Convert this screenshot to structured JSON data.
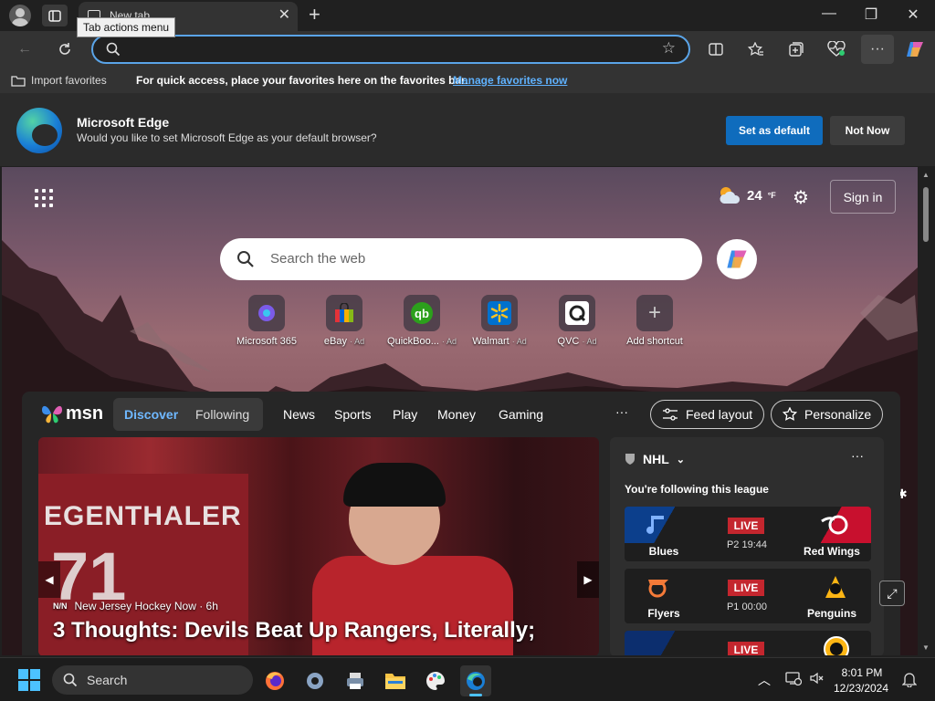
{
  "browser": {
    "tab_title": "New tab",
    "tooltip": "Tab actions menu",
    "address_value": "",
    "favorites_bar": {
      "import_label": "Import favorites",
      "hint": "For quick access, place your favorites here on the favorites bar.",
      "manage_link": "Manage favorites now"
    }
  },
  "banner": {
    "title": "Microsoft Edge",
    "message": "Would you like to set Microsoft Edge as your default browser?",
    "set_default": "Set as default",
    "not_now": "Not Now"
  },
  "ntp": {
    "weather_temp": "24",
    "weather_unit": "°F",
    "signin": "Sign in",
    "search_placeholder": "Search the web",
    "tiles": [
      {
        "label": "Microsoft 365",
        "ad": ""
      },
      {
        "label": "eBay",
        "ad": "· Ad"
      },
      {
        "label": "QuickBoo...",
        "ad": "· Ad"
      },
      {
        "label": "Walmart",
        "ad": "· Ad"
      },
      {
        "label": "QVC",
        "ad": "· Ad"
      },
      {
        "label": "Add shortcut",
        "ad": ""
      }
    ]
  },
  "msn": {
    "logo": "msn",
    "tabs": [
      "Discover",
      "Following"
    ],
    "nav": [
      "News",
      "Sports",
      "Play",
      "Money",
      "Gaming"
    ],
    "more": "···",
    "feed_layout": "Feed layout",
    "personalize": "Personalize",
    "hero": {
      "source_badge": "N/N",
      "source": "New Jersey Hockey Now · 6h",
      "headline": "3 Thoughts: Devils Beat Up Rangers, Literally;",
      "jersey_name": "EGENTHALER",
      "jersey_number": "71"
    },
    "nhl": {
      "league": "NHL",
      "following_text": "You're following this league",
      "games": [
        {
          "left": "Blues",
          "right": "Red Wings",
          "status": "LIVE",
          "time": "P2 19:44",
          "lcolor": "#0c3f8c",
          "rcolor": "#c8102e"
        },
        {
          "left": "Flyers",
          "right": "Penguins",
          "status": "LIVE",
          "time": "P1 00:00",
          "lcolor": "#1e1e1e",
          "rcolor": "#1e1e1e"
        },
        {
          "left": "",
          "right": "",
          "status": "LIVE",
          "time": "",
          "lcolor": "#0c2e6e",
          "rcolor": "#1e1e1e"
        }
      ]
    }
  },
  "taskbar": {
    "search_label": "Search",
    "time": "8:01 PM",
    "date": "12/23/2024"
  },
  "colors": {
    "accent": "#0f6cbd",
    "link": "#5fb2ff",
    "live": "#c4262e",
    "discover": "#6fb8ff"
  }
}
